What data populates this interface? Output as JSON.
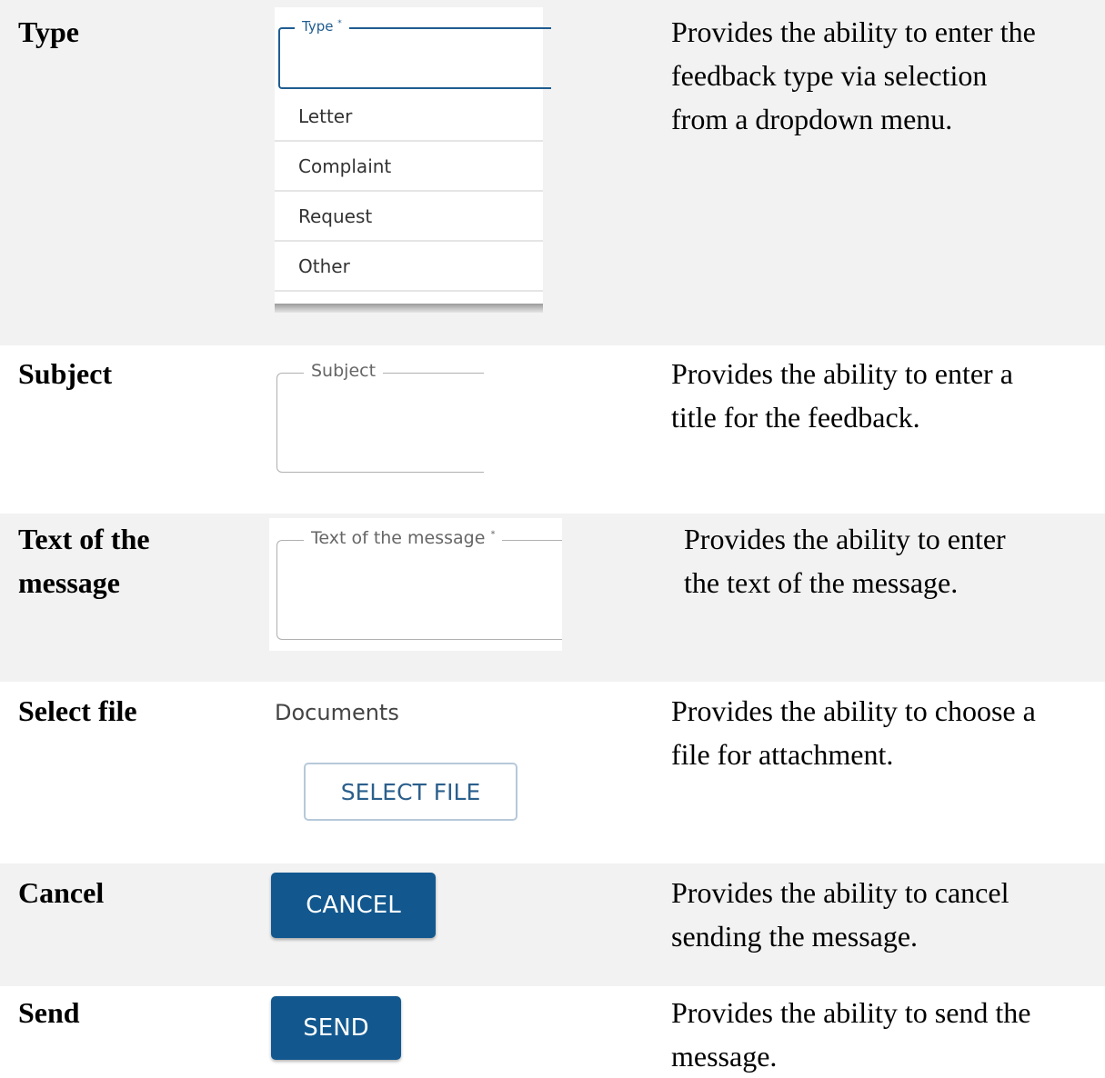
{
  "rows": {
    "type": {
      "term": "Type",
      "field_label": "Type",
      "required_mark": "*",
      "options": [
        "Letter",
        "Complaint",
        "Request",
        "Other"
      ],
      "desc_lines": [
        "Provides the ability to enter the",
        "feedback type via selection",
        "from a dropdown menu."
      ]
    },
    "subject": {
      "term": "Subject",
      "field_label": "Subject",
      "desc_lines": [
        "Provides the ability to enter a",
        "title for the feedback."
      ]
    },
    "message": {
      "term_lines": [
        "Text of the",
        "message"
      ],
      "field_label": "Text of the message",
      "required_mark": "*",
      "desc_lines": [
        "Provides the ability to enter",
        "the text of the message."
      ]
    },
    "select_file": {
      "term": "Select file",
      "section_label": "Documents",
      "button_label": "SELECT FILE",
      "desc_lines": [
        "Provides the ability to choose a",
        "file for attachment."
      ]
    },
    "cancel": {
      "term": "Cancel",
      "button_label": "CANCEL",
      "desc_lines": [
        "Provides the ability to cancel",
        "sending the message."
      ]
    },
    "send": {
      "term": "Send",
      "button_label": "SEND",
      "desc_lines": [
        "Provides the ability to send the",
        "message."
      ]
    }
  },
  "colors": {
    "accent": "#1f5d90",
    "button_primary": "#12588f",
    "row_shade": "#f2f2f2"
  }
}
